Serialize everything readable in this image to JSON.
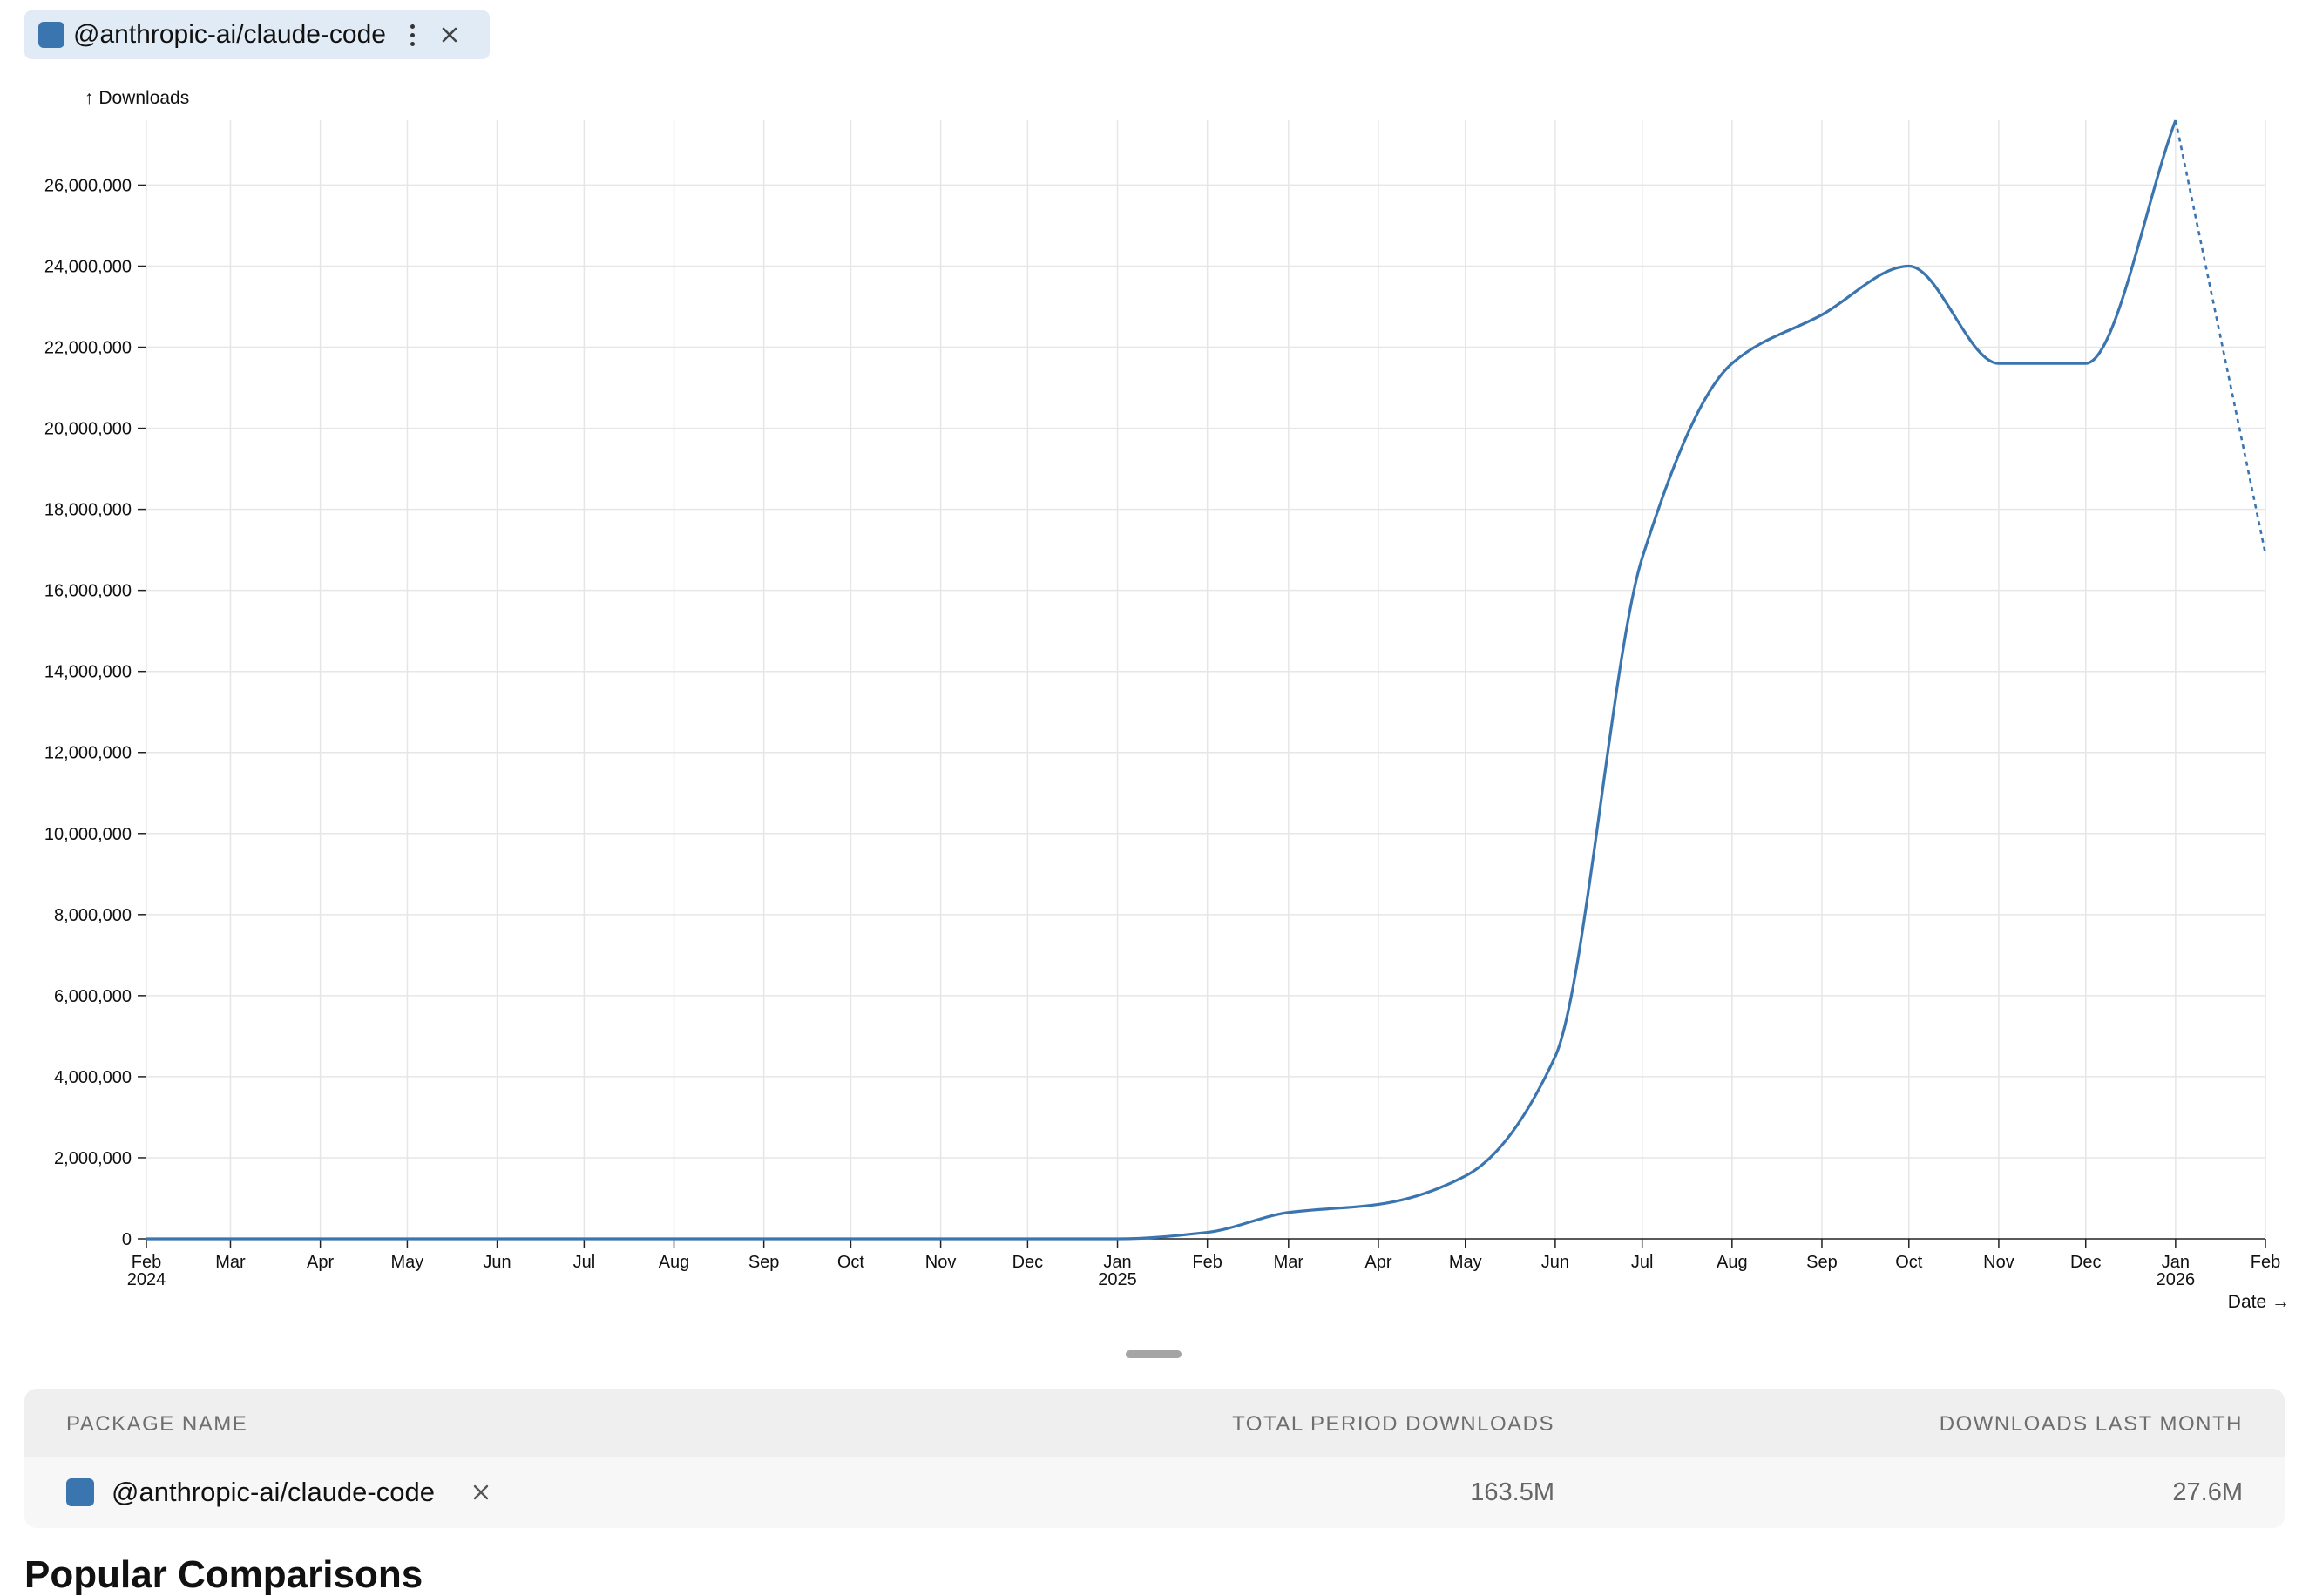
{
  "package": {
    "name": "@anthropic-ai/claude-code",
    "color": "#3b75af"
  },
  "chart_data": {
    "type": "line",
    "ylabel": "↑ Downloads",
    "xlabel": "Date →",
    "ylim": [
      0,
      27600000
    ],
    "grid": true,
    "y_ticks": [
      0,
      2000000,
      4000000,
      6000000,
      8000000,
      10000000,
      12000000,
      14000000,
      16000000,
      18000000,
      20000000,
      22000000,
      24000000,
      26000000
    ],
    "y_tick_labels": [
      "0",
      "2,000,000",
      "4,000,000",
      "6,000,000",
      "8,000,000",
      "10,000,000",
      "12,000,000",
      "14,000,000",
      "16,000,000",
      "18,000,000",
      "20,000,000",
      "22,000,000",
      "24,000,000",
      "26,000,000"
    ],
    "x_ticks": [
      {
        "date": "2024-02-01",
        "label": "Feb",
        "year": "2024"
      },
      {
        "date": "2024-03-01",
        "label": "Mar"
      },
      {
        "date": "2024-04-01",
        "label": "Apr"
      },
      {
        "date": "2024-05-01",
        "label": "May"
      },
      {
        "date": "2024-06-01",
        "label": "Jun"
      },
      {
        "date": "2024-07-01",
        "label": "Jul"
      },
      {
        "date": "2024-08-01",
        "label": "Aug"
      },
      {
        "date": "2024-09-01",
        "label": "Sep"
      },
      {
        "date": "2024-10-01",
        "label": "Oct"
      },
      {
        "date": "2024-11-01",
        "label": "Nov"
      },
      {
        "date": "2024-12-01",
        "label": "Dec"
      },
      {
        "date": "2025-01-01",
        "label": "Jan",
        "year": "2025"
      },
      {
        "date": "2025-02-01",
        "label": "Feb"
      },
      {
        "date": "2025-03-01",
        "label": "Mar"
      },
      {
        "date": "2025-04-01",
        "label": "Apr"
      },
      {
        "date": "2025-05-01",
        "label": "May"
      },
      {
        "date": "2025-06-01",
        "label": "Jun"
      },
      {
        "date": "2025-07-01",
        "label": "Jul"
      },
      {
        "date": "2025-08-01",
        "label": "Aug"
      },
      {
        "date": "2025-09-01",
        "label": "Sep"
      },
      {
        "date": "2025-10-01",
        "label": "Oct"
      },
      {
        "date": "2025-11-01",
        "label": "Nov"
      },
      {
        "date": "2025-12-01",
        "label": "Dec"
      },
      {
        "date": "2026-01-01",
        "label": "Jan",
        "year": "2026"
      },
      {
        "date": "2026-02-01",
        "label": "Feb"
      }
    ],
    "series": [
      {
        "name": "@anthropic-ai/claude-code",
        "color": "#3b75af",
        "points": [
          {
            "x": "2024-02-01",
            "y": 0
          },
          {
            "x": "2024-03-01",
            "y": 0
          },
          {
            "x": "2024-04-01",
            "y": 0
          },
          {
            "x": "2024-05-01",
            "y": 0
          },
          {
            "x": "2024-06-01",
            "y": 0
          },
          {
            "x": "2024-07-01",
            "y": 0
          },
          {
            "x": "2024-08-01",
            "y": 0
          },
          {
            "x": "2024-09-01",
            "y": 0
          },
          {
            "x": "2024-10-01",
            "y": 0
          },
          {
            "x": "2024-11-01",
            "y": 0
          },
          {
            "x": "2024-12-01",
            "y": 0
          },
          {
            "x": "2025-01-01",
            "y": 0
          },
          {
            "x": "2025-02-01",
            "y": 160000
          },
          {
            "x": "2025-03-01",
            "y": 650000
          },
          {
            "x": "2025-04-01",
            "y": 850000
          },
          {
            "x": "2025-05-01",
            "y": 1550000
          },
          {
            "x": "2025-06-01",
            "y": 4500000
          },
          {
            "x": "2025-07-01",
            "y": 16800000
          },
          {
            "x": "2025-08-01",
            "y": 21600000
          },
          {
            "x": "2025-09-01",
            "y": 22800000
          },
          {
            "x": "2025-10-01",
            "y": 24000000
          },
          {
            "x": "2025-11-01",
            "y": 21600000
          },
          {
            "x": "2025-12-01",
            "y": 21600000
          },
          {
            "x": "2026-01-01",
            "y": 27600000
          }
        ],
        "partial": [
          {
            "x": "2026-01-01",
            "y": 27600000
          },
          {
            "x": "2026-02-01",
            "y": 16900000
          }
        ]
      }
    ]
  },
  "table": {
    "headers": {
      "name": "PACKAGE NAME",
      "total": "TOTAL PERIOD DOWNLOADS",
      "last_month": "DOWNLOADS LAST MONTH"
    },
    "rows": [
      {
        "name": "@anthropic-ai/claude-code",
        "total": "163.5M",
        "last_month": "27.6M"
      }
    ]
  },
  "next_section": {
    "heading": "Popular Comparisons"
  },
  "icons": {
    "menu": "vertical-ellipsis-icon",
    "close": "close-icon",
    "remove": "remove-x-icon"
  }
}
